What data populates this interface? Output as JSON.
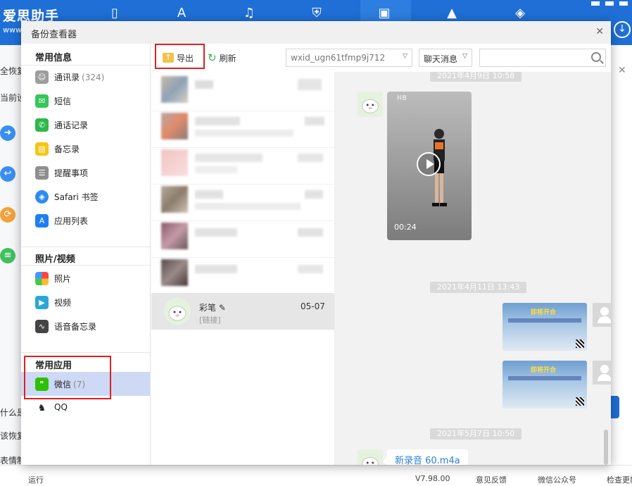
{
  "app": {
    "logo": "爱思助手",
    "logo_sub": "www",
    "nav_icons": [
      "phone-icon",
      "app-store-icon",
      "music-icon",
      "shield-icon",
      "toolbox-icon",
      "graduation-cap-icon",
      "compass-icon"
    ]
  },
  "background": {
    "left_texts": [
      "全恢复",
      "当前设",
      "什么是",
      "该恢复",
      "表情制"
    ],
    "bottom_texts": [
      "运行",
      "V7.98.00",
      "意见反馈",
      "微信公众号",
      "检查更新"
    ]
  },
  "dialog": {
    "title": "备份查看器"
  },
  "sidebar": {
    "sections": [
      {
        "title": "常用信息",
        "items": [
          {
            "label": "通讯录",
            "count": "(324)",
            "icon": "contacts-icon",
            "color": "#9e9e9e"
          },
          {
            "label": "短信",
            "count": "",
            "icon": "messages-icon",
            "color": "#35c759"
          },
          {
            "label": "通话记录",
            "count": "",
            "icon": "phone-call-icon",
            "color": "#2fb84a"
          },
          {
            "label": "备忘录",
            "count": "",
            "icon": "notes-icon",
            "color": "#f5c518"
          },
          {
            "label": "提醒事项",
            "count": "",
            "icon": "reminders-icon",
            "color": "#8e8e8e"
          },
          {
            "label": "Safari 书签",
            "count": "",
            "icon": "safari-icon",
            "color": "#2d8cf0"
          },
          {
            "label": "应用列表",
            "count": "",
            "icon": "app-store-icon",
            "color": "#1e7ff0"
          }
        ]
      },
      {
        "title": "照片/视频",
        "items": [
          {
            "label": "照片",
            "count": "",
            "icon": "photos-icon",
            "color": "#f29b30"
          },
          {
            "label": "视频",
            "count": "",
            "icon": "video-icon",
            "color": "#2aa7d9"
          },
          {
            "label": "语音备忘录",
            "count": "",
            "icon": "voice-memo-icon",
            "color": "#444444"
          }
        ]
      },
      {
        "title": "常用应用",
        "items": [
          {
            "label": "微信",
            "count": "(7)",
            "icon": "wechat-icon",
            "color": "#2dc100"
          },
          {
            "label": "QQ",
            "count": "",
            "icon": "qq-icon",
            "color": "#333333"
          }
        ]
      }
    ]
  },
  "toolbar": {
    "export_label": "导出",
    "refresh_label": "刷新",
    "account_select": "wxid_ugn61tfmp9j712",
    "type_select": "聊天消息",
    "search_placeholder": ""
  },
  "conversations": {
    "selected": {
      "name": "彩笔",
      "date": "05-07",
      "snippet": "[链接]"
    }
  },
  "chat": {
    "timestamps": [
      "2021年4月9日 10:58",
      "2021年4月11日 13:43",
      "2021年5月7日 10:50"
    ],
    "video": {
      "duration": "00:24",
      "brand": "抖音"
    },
    "image_banner": "即将开合",
    "voice_file": "新录音 60.m4a"
  },
  "colors": {
    "brand_blue": "#1f6fd6",
    "highlight_red": "#e02020",
    "selected_nav": "#cdd9f5",
    "link_blue": "#2a7fd4"
  }
}
